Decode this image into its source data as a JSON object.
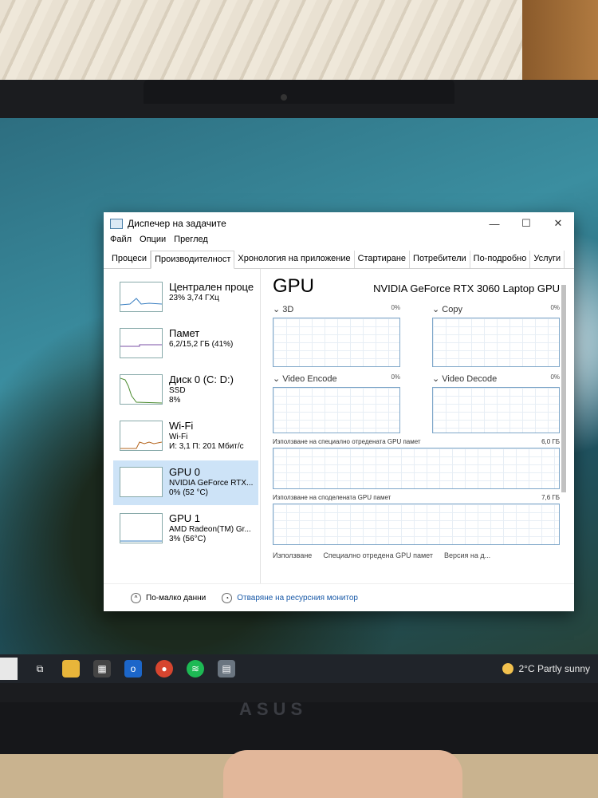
{
  "window": {
    "title": "Диспечер на задачите",
    "controls": {
      "minimize": "—",
      "maximize": "☐",
      "close": "✕"
    }
  },
  "menu": [
    "Файл",
    "Опции",
    "Преглед"
  ],
  "tabs": [
    "Процеси",
    "Производителност",
    "Хронология на приложение",
    "Стартиране",
    "Потребители",
    "По-подробно",
    "Услуги"
  ],
  "sidebar": [
    {
      "title": "Централен проце",
      "line1": "23% 3,74 ГХц",
      "line2": ""
    },
    {
      "title": "Памет",
      "line1": "6,2/15,2 ГБ (41%)",
      "line2": ""
    },
    {
      "title": "Диск 0 (C: D:)",
      "line1": "SSD",
      "line2": "8%"
    },
    {
      "title": "Wi-Fi",
      "line1": "Wi-Fi",
      "line2": "И: 3,1 П: 201 Мбит/с"
    },
    {
      "title": "GPU 0",
      "line1": "NVIDIA GeForce RTX...",
      "line2": "0% (52 °C)"
    },
    {
      "title": "GPU 1",
      "line1": "AMD Radeon(TM) Gr...",
      "line2": "3% (56°C)"
    }
  ],
  "main": {
    "title": "GPU",
    "model": "NVIDIA GeForce RTX 3060 Laptop GPU",
    "engines": [
      {
        "name": "3D",
        "pct": "0%"
      },
      {
        "name": "Copy",
        "pct": "0%"
      },
      {
        "name": "Video Encode",
        "pct": "0%"
      },
      {
        "name": "Video Decode",
        "pct": "0%"
      }
    ],
    "dedicated_label": "Използване на специално отредената GPU памет",
    "dedicated_max": "6,0 ГБ",
    "shared_label": "Използване на споделената GPU памет",
    "shared_max": "7,6 ГБ",
    "stats": [
      "Използване",
      "Специално отредена GPU памет",
      "Версия на д..."
    ]
  },
  "footer": {
    "fewer_details": "По-малко данни",
    "resource_monitor": "Отваряне на ресурсния монитор"
  },
  "taskbar": {
    "weather": "2°C Partly sunny"
  },
  "laptop_brand": "ASUS"
}
